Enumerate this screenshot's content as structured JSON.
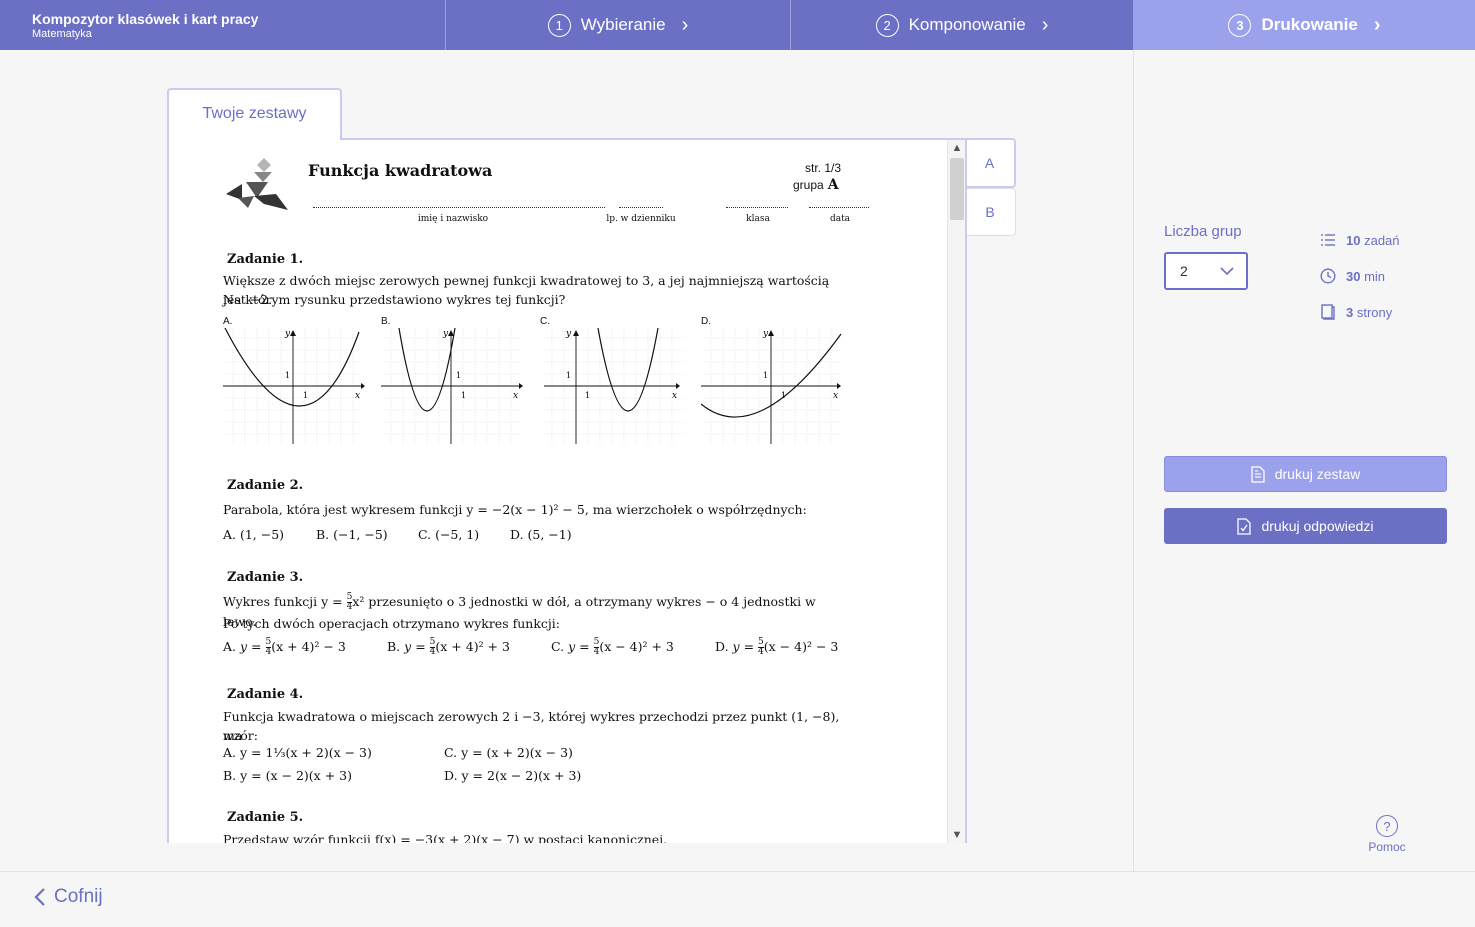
{
  "app": {
    "title": "Kompozytor klasówek i kart pracy",
    "subtitle": "Matematyka"
  },
  "steps": [
    {
      "num": "1",
      "label": "Wybieranie"
    },
    {
      "num": "2",
      "label": "Komponowanie"
    },
    {
      "num": "3",
      "label": "Drukowanie"
    }
  ],
  "tabs": {
    "main": "Twoje zestawy",
    "groups": [
      "A",
      "B"
    ]
  },
  "settings": {
    "groups_label": "Liczba grup",
    "groups_value": "2",
    "stats": [
      {
        "icon": "list-icon",
        "value": "10",
        "unit": "zadań"
      },
      {
        "icon": "clock-icon",
        "value": "30",
        "unit": "min"
      },
      {
        "icon": "pages-icon",
        "value": "3",
        "unit": "strony"
      }
    ],
    "print_set": "drukuj zestaw",
    "print_answers": "drukuj odpowiedzi",
    "help": "Pomoc"
  },
  "footer": {
    "back": "Cofnij"
  },
  "document": {
    "title": "Funkcja kwadratowa",
    "page": "str. 1/3",
    "group_label": "grupa",
    "group_value": "A",
    "fields": [
      "imię i nazwisko",
      "lp. w dzienniku",
      "klasa",
      "data"
    ],
    "tasks": [
      {
        "title": "Zadanie 1.",
        "text": [
          "Większe z dwóch miejsc zerowych pewnej funkcji kwadratowej to 3, a jej najmniejszą wartością jest −2.",
          "Na którym rysunku przedstawiono wykres tej funkcji?"
        ],
        "graph_labels": [
          "A.",
          "B.",
          "C.",
          "D."
        ]
      },
      {
        "title": "Zadanie 2.",
        "text": [
          "Parabola, która jest wykresem funkcji  y = −2(x − 1)² − 5,  ma wierzchołek o współrzędnych:"
        ],
        "answers": [
          "A. (1, −5)",
          "B. (−1, −5)",
          "C. (−5, 1)",
          "D. (5, −1)"
        ]
      },
      {
        "title": "Zadanie 3.",
        "text_pre": "Wykres funkcji  y =",
        "text_post": "x²  przesunięto o 3 jednostki w dół, a otrzymany wykres − o 4 jednostki w lewo.",
        "text2": "Po tych dwóch operacjach otrzymano wykres funkcji:",
        "answers": [
          {
            "label": "A.",
            "pre": "y =",
            "post": "(x + 4)² − 3"
          },
          {
            "label": "B.",
            "pre": "y =",
            "post": "(x + 4)² + 3"
          },
          {
            "label": "C.",
            "pre": "y =",
            "post": "(x − 4)² + 3"
          },
          {
            "label": "D.",
            "pre": "y =",
            "post": "(x − 4)² − 3"
          }
        ],
        "frac_num": "5",
        "frac_den": "4"
      },
      {
        "title": "Zadanie 4.",
        "text": [
          "Funkcja kwadratowa o miejscach zerowych 2 i −3, której wykres przechodzi przez punkt (1, −8), ma",
          "wzór:"
        ],
        "answers": [
          "A. y = 1⅓(x + 2)(x − 3)",
          "C. y = (x + 2)(x − 3)",
          "B. y = (x − 2)(x + 3)",
          "D. y = 2(x − 2)(x + 3)"
        ]
      },
      {
        "title": "Zadanie 5.",
        "text": [
          "Przedstaw wzór funkcji  f(x) = −3(x + 2)(x − 7) w postaci kanonicznej."
        ]
      }
    ]
  },
  "colors": {
    "accent": "#6b70c4",
    "accent_light": "#9ca1ec",
    "border": "#c9cbf0"
  }
}
